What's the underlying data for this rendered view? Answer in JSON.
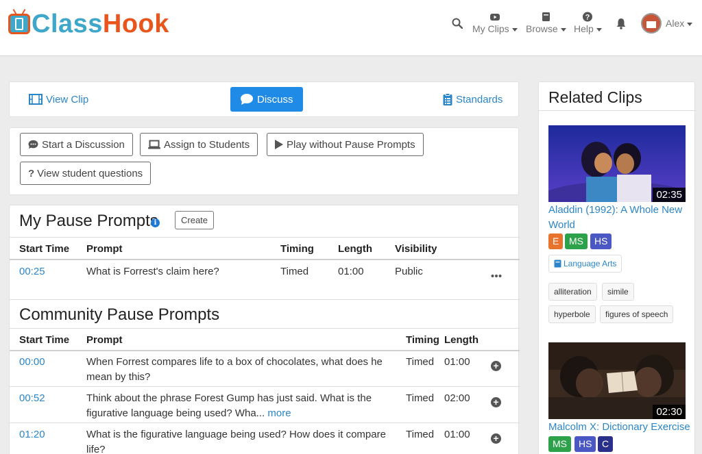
{
  "brand": {
    "part1": "Class",
    "part2": "Hook"
  },
  "nav": {
    "my_clips": "My Clips",
    "browse": "Browse",
    "help": "Help",
    "user": "Alex"
  },
  "tabs": {
    "view_clip": "View Clip",
    "discuss": "Discuss",
    "standards": "Standards"
  },
  "actions": {
    "start_discussion": "Start a Discussion",
    "assign": "Assign to Students",
    "play_without": "Play without Pause Prompts",
    "view_questions": "View student questions"
  },
  "my_prompts": {
    "title": "My Pause Prompts",
    "create": "Create",
    "headers": {
      "start": "Start Time",
      "prompt": "Prompt",
      "timing": "Timing",
      "length": "Length",
      "visibility": "Visibility"
    },
    "rows": [
      {
        "start": "00:25",
        "prompt": "What is Forrest's claim here?",
        "timing": "Timed",
        "length": "01:00",
        "visibility": "Public"
      }
    ]
  },
  "community": {
    "title": "Community Pause Prompts",
    "headers": {
      "start": "Start Time",
      "prompt": "Prompt",
      "timing": "Timing",
      "length": "Length"
    },
    "rows": [
      {
        "start": "00:00",
        "prompt": "When Forrest compares life to a box of chocolates, what does he mean by this?",
        "timing": "Timed",
        "length": "01:00"
      },
      {
        "start": "00:52",
        "prompt": "Think about the phrase Forest Gump has just said. What is the figurative language being used? Wha...",
        "more": "more",
        "timing": "Timed",
        "length": "02:00"
      },
      {
        "start": "01:20",
        "prompt": "What is the figurative language being used? How does it compare life?",
        "timing": "Timed",
        "length": "01:00"
      }
    ]
  },
  "related": {
    "title": "Related Clips",
    "clips": [
      {
        "duration": "02:35",
        "title": "Aladdin (1992): A Whole New World",
        "badges": [
          "E",
          "MS",
          "HS"
        ],
        "subject": "Language Arts",
        "tags": [
          "alliteration",
          "simile",
          "hyperbole",
          "figures of speech"
        ]
      },
      {
        "duration": "02:30",
        "title": "Malcolm X: Dictionary Exercise",
        "badges": [
          "MS",
          "HS",
          "C"
        ]
      }
    ]
  },
  "colors": {
    "accent": "#1f8be6",
    "link": "#2a86c8",
    "badge_e": "#e8732c",
    "badge_ms": "#2ea24a",
    "badge_hs": "#4b58c4",
    "badge_c": "#2a2f8a"
  }
}
